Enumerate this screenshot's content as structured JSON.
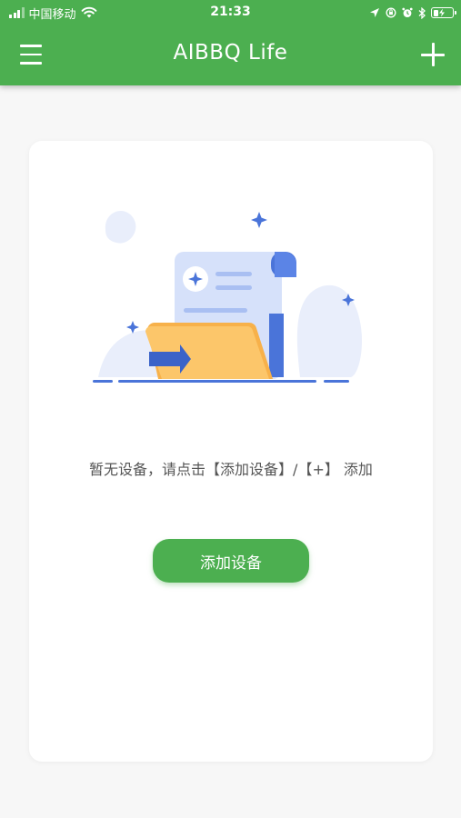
{
  "status_bar": {
    "carrier": "中国移动",
    "time": "21:33"
  },
  "app_bar": {
    "title": "AIBBQ Life"
  },
  "empty_state": {
    "message": "暂无设备，请点击【添加设备】/【+】 添加",
    "button_label": "添加设备"
  },
  "colors": {
    "primary": "#4caf50",
    "background": "#f7f7f7",
    "card": "#ffffff",
    "text_secondary": "#555555",
    "illustration_blue": "#4a74d9",
    "illustration_folder": "#f7b14a"
  },
  "icons": {
    "menu": "menu-icon",
    "add": "plus-icon",
    "signal": "cellular-signal-icon",
    "wifi": "wifi-icon",
    "location": "location-arrow-icon",
    "lock_rotation": "orientation-lock-icon",
    "alarm": "alarm-icon",
    "bluetooth": "bluetooth-icon",
    "battery": "battery-charging-icon"
  }
}
